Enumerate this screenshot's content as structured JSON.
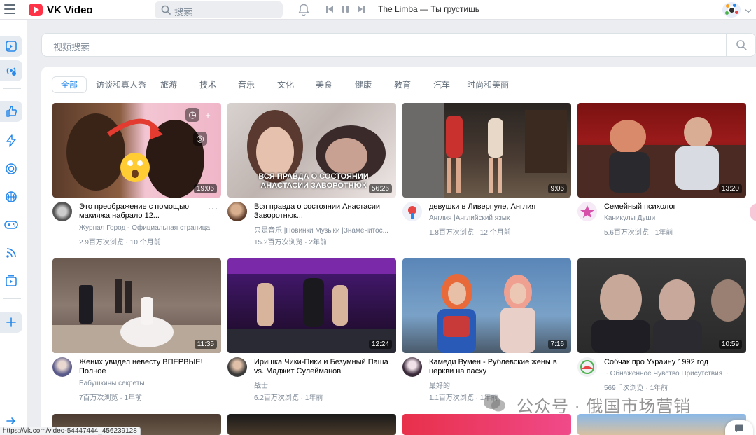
{
  "app": {
    "brand": "VK Video"
  },
  "topbar": {
    "search_placeholder": "搜索",
    "now_playing": "The Limba — Ты грустишь",
    "icons": [
      "menu-icon",
      "bell-icon",
      "prev-icon",
      "pause-icon",
      "next-icon",
      "search-icon",
      "chevron-down-icon"
    ]
  },
  "main_search": {
    "placeholder": "视频搜索"
  },
  "tabs": [
    {
      "label": "全部",
      "active": true
    },
    {
      "label": "访谈和真人秀"
    },
    {
      "label": "旅游"
    },
    {
      "label": "技术"
    },
    {
      "label": "音乐"
    },
    {
      "label": "文化"
    },
    {
      "label": "美食"
    },
    {
      "label": "健康"
    },
    {
      "label": "教育"
    },
    {
      "label": "汽车"
    },
    {
      "label": "时尚和美丽"
    }
  ],
  "videos": [
    {
      "title": "Это преображение с помощью макияжа набрало 12...",
      "channel": "Журнал Город - Официальная страница",
      "meta": "2.9百万次浏览 · 10 个月前",
      "duration": "19:06"
    },
    {
      "title": "Вся правда о состоянии Анастасии Заворотнюк...",
      "channel": "只是音乐 |Новинки Музыки |Знаменитос...",
      "meta": "15.2百万次浏览 · 2年前",
      "duration": "56:26",
      "thumb_caption": "ВСЯ ПРАВДА О СОСТОЯНИИ АНАСТАСИИ ЗАВОРОТНЮК"
    },
    {
      "title": "девушки в Ливерпуле, Англия",
      "channel": "Англия |Английский язык",
      "meta": "1.8百万次浏览 · 12 个月前",
      "duration": "9:06"
    },
    {
      "title": "Семейный психолог",
      "channel": "Каникулы Души",
      "meta": "5.6百万次浏览 · 1年前",
      "duration": "13:20"
    },
    {
      "title": "Жених увидел невесту ВПЕРВЫЕ! Полное",
      "channel": "Бабушкины секреты",
      "meta": "7百万次浏览 · 1年前",
      "duration": "11:35"
    },
    {
      "title": "Иришка Чики-Пики и Безумный Паша vs. Маджит Сулейманов",
      "channel": "战士",
      "meta": "6.2百万次浏览 · 1年前",
      "duration": "12:24"
    },
    {
      "title": "Камеди Вумен - Рублевские жены в церкви на пасху",
      "channel": "最好的",
      "meta": "1.1百万次浏览 · 1年前",
      "duration": "7:16"
    },
    {
      "title": "Собчак про Украину 1992 год",
      "channel": "~ Обнажённое Чувство Присутствия ~",
      "meta": "569千次浏览 · 1年前",
      "duration": "10:59"
    }
  ],
  "status_bar": {
    "url": "https://vk.com/video-54447444_456239128"
  },
  "watermark": {
    "text": "公众号 · 俄国市场营销"
  }
}
